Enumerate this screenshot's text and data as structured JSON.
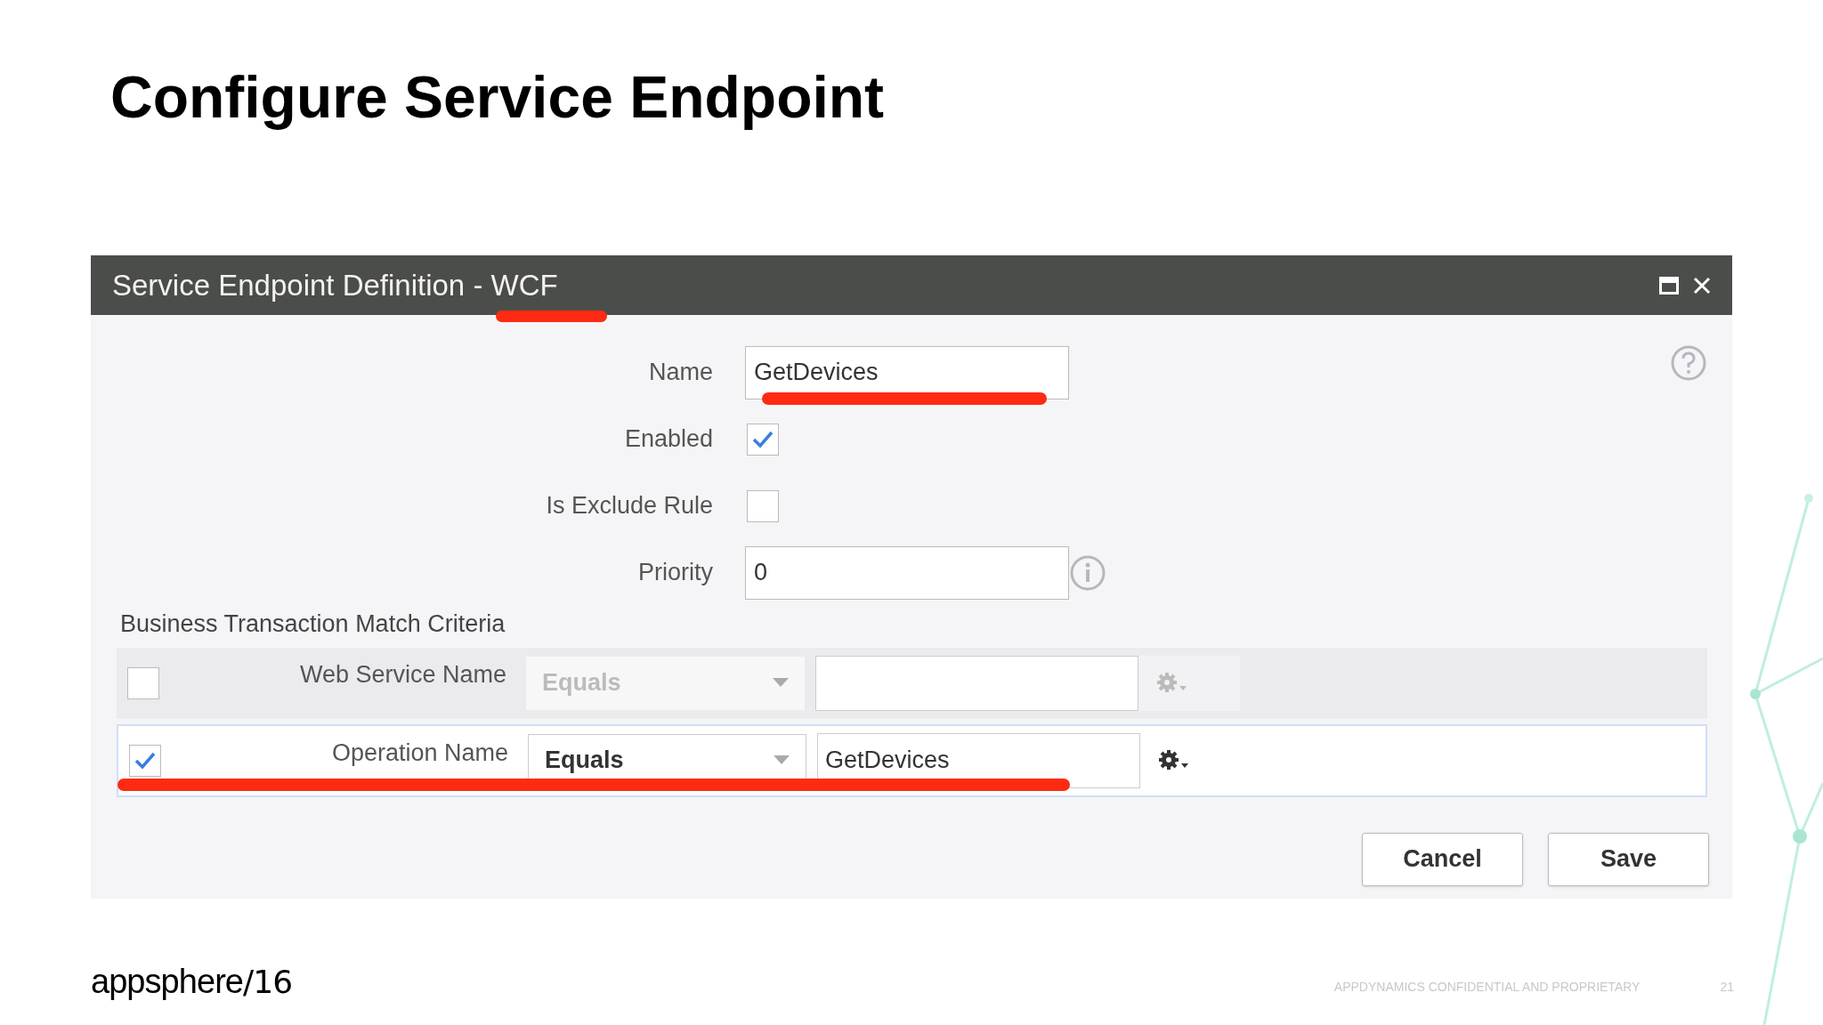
{
  "slide": {
    "title": "Configure Service Endpoint"
  },
  "dialog": {
    "title": "Service Endpoint Definition - WCF",
    "fields": [
      {
        "kind": "text",
        "label": "Name",
        "value": "GetDevices"
      },
      {
        "kind": "checkbox",
        "label": "Enabled",
        "checked": true
      },
      {
        "kind": "checkbox",
        "label": "Is Exclude Rule",
        "checked": false
      },
      {
        "kind": "text",
        "label": "Priority",
        "value": "0",
        "info": true
      }
    ],
    "section_title": "Business Transaction Match Criteria",
    "criteria": [
      {
        "label": "Web Service Name",
        "checked": false,
        "operator": "Equals"
      },
      {
        "label": "Operation Name",
        "checked": true,
        "operator": "Equals",
        "value": "GetDevices"
      }
    ],
    "buttons": [
      "Cancel",
      "Save"
    ]
  },
  "footer": {
    "logo": "appsphere",
    "logo_suffix": "/16",
    "notice": "APPDYNAMICS CONFIDENTIAL AND PROPRIETARY",
    "page": "21"
  }
}
